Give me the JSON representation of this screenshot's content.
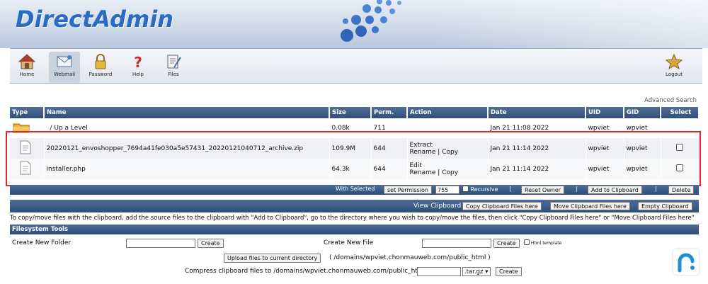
{
  "header": {
    "logo_text": "DirectAdmin"
  },
  "toolbar": {
    "items": [
      {
        "label": "Home",
        "icon": "home-icon"
      },
      {
        "label": "Webmail",
        "icon": "webmail-icon"
      },
      {
        "label": "Password",
        "icon": "padlock-icon"
      },
      {
        "label": "Help",
        "icon": "question-mark-icon"
      },
      {
        "label": "Files",
        "icon": "files-icon"
      }
    ],
    "logout_label": "Logout"
  },
  "advanced_search": "Advanced Search",
  "table": {
    "headers": [
      "Type",
      "Name",
      "Size",
      "Perm.",
      "Action",
      "Date",
      "UID",
      "GID",
      "Select"
    ],
    "up_row": {
      "name": "/ Up a Level",
      "size": "0.08k",
      "perm": "711",
      "date": "Jan 21 11:08 2022",
      "uid": "wpviet",
      "gid": "wpviet"
    },
    "rows": [
      {
        "name": "20220121_envoshopper_7694a41fe030a5e57431_20220121040712_archive.zip",
        "size": "109.9M",
        "perm": "644",
        "action_primary": "Extract",
        "rename": "Rename",
        "sep": "|",
        "copy": "Copy",
        "date": "Jan 21 11:14 2022",
        "uid": "wpviet",
        "gid": "wpviet"
      },
      {
        "name": "installer.php",
        "size": "64.3k",
        "perm": "644",
        "action_primary": "Edit",
        "rename": "Rename",
        "sep": "|",
        "copy": "Copy",
        "date": "Jan 21 11:14 2022",
        "uid": "wpviet",
        "gid": "wpviet"
      }
    ]
  },
  "with_selected": {
    "label": "With Selected",
    "set_permission": "set Permission",
    "permission_value": "755",
    "recursive": "Recursive",
    "sep": "|",
    "reset_owner": "Reset Owner",
    "add_to_clipboard": "Add to Clipboard",
    "delete": "Delete"
  },
  "clipboard": {
    "label": "View Clipboard",
    "copy_here": "Copy Clipboard Files here",
    "move_here": "Move Clipboard Files here",
    "empty": "Empty Clipboard"
  },
  "help_text": "To copy/move files with the clipboard, add the source files to the clipboard with \"Add to Clipboard\", go to the directory where you wish to copy/move the files, then click \"Copy Clipboard Files here\" or \"Move Clipboard Files here\"",
  "fs_tools": {
    "title": "Filesystem Tools",
    "new_folder_label": "Create New Folder",
    "new_file_label": "Create New File",
    "create": "Create",
    "html_template": "Html template",
    "upload_button": "Upload files to current directory",
    "upload_path": "( /domains/wpviet.chonmauweb.com/public_html )",
    "compress_label": "Compress clipboard files to /domains/wpviet.chonmauweb.com/public_html/",
    "compress_ext": ".tar.gz"
  },
  "colors": {
    "accent": "#2b6cc2",
    "header_bar": "#3a5a85",
    "highlight": "#e0252b"
  }
}
